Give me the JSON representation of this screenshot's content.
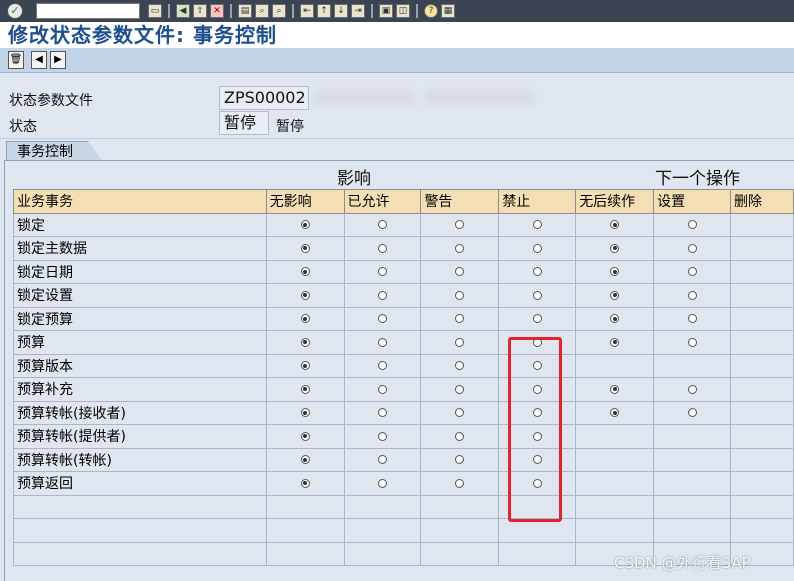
{
  "window": {
    "title": "修改状态参数文件: 事务控制"
  },
  "toolbar": {
    "icons": [
      "enter-icon",
      "command-field",
      "save-icon",
      "back-icon",
      "exit-icon",
      "cancel-icon",
      "print-icon",
      "find-icon",
      "find-next-icon",
      "first-page-icon",
      "prev-page-icon",
      "next-page-icon",
      "last-page-icon",
      "new-session-icon",
      "shortcut-icon",
      "help-icon",
      "layout-icon"
    ]
  },
  "app_toolbar": {
    "buttons": [
      "delete-icon",
      "previous-icon",
      "next-icon"
    ]
  },
  "header": {
    "profile_label": "状态参数文件",
    "profile_value": "ZPS00002",
    "status_label": "状态",
    "status_value": "暂停",
    "status_text": "暂停"
  },
  "tab": {
    "label": "事务控制"
  },
  "groups": {
    "influence": "影响",
    "next_action": "下一个操作"
  },
  "table": {
    "headers": [
      "业务事务",
      "无影响",
      "已允许",
      "警告",
      "禁止",
      "无后续作",
      "设置",
      "删除"
    ],
    "rows": [
      {
        "name": "锁定",
        "cells": [
          "on",
          "off",
          "off",
          "off",
          "on",
          "off",
          ""
        ]
      },
      {
        "name": "锁定主数据",
        "cells": [
          "on",
          "off",
          "off",
          "off",
          "on",
          "off",
          ""
        ]
      },
      {
        "name": "锁定日期",
        "cells": [
          "on",
          "off",
          "off",
          "off",
          "on",
          "off",
          ""
        ]
      },
      {
        "name": "锁定设置",
        "cells": [
          "on",
          "off",
          "off",
          "off",
          "on",
          "off",
          ""
        ]
      },
      {
        "name": "锁定预算",
        "cells": [
          "on",
          "off",
          "off",
          "off",
          "on",
          "off",
          ""
        ]
      },
      {
        "name": "预算",
        "cells": [
          "on",
          "off",
          "off",
          "off",
          "on",
          "off",
          ""
        ]
      },
      {
        "name": "预算版本",
        "cells": [
          "on",
          "off",
          "off",
          "off",
          "",
          "",
          ""
        ]
      },
      {
        "name": "预算补充",
        "cells": [
          "on",
          "off",
          "off",
          "off",
          "on",
          "off",
          ""
        ]
      },
      {
        "name": "预算转帐(接收者)",
        "cells": [
          "on",
          "off",
          "off",
          "off",
          "on",
          "off",
          ""
        ]
      },
      {
        "name": "预算转帐(提供者)",
        "cells": [
          "on",
          "off",
          "off",
          "off",
          "",
          "",
          ""
        ]
      },
      {
        "name": "预算转帐(转帐)",
        "cells": [
          "on",
          "off",
          "off",
          "off",
          "",
          "",
          ""
        ]
      },
      {
        "name": "预算返回",
        "cells": [
          "on",
          "off",
          "off",
          "off",
          "",
          "",
          ""
        ]
      },
      {
        "name": "",
        "cells": [
          "",
          "",
          "",
          "",
          "",
          "",
          ""
        ]
      },
      {
        "name": "",
        "cells": [
          "",
          "",
          "",
          "",
          "",
          "",
          ""
        ]
      },
      {
        "name": "",
        "cells": [
          "",
          "",
          "",
          "",
          "",
          "",
          ""
        ]
      }
    ]
  },
  "annotation": {
    "highlight_color": "#e0262a"
  },
  "watermark": {
    "text": "CSDN @外行看SAP"
  }
}
